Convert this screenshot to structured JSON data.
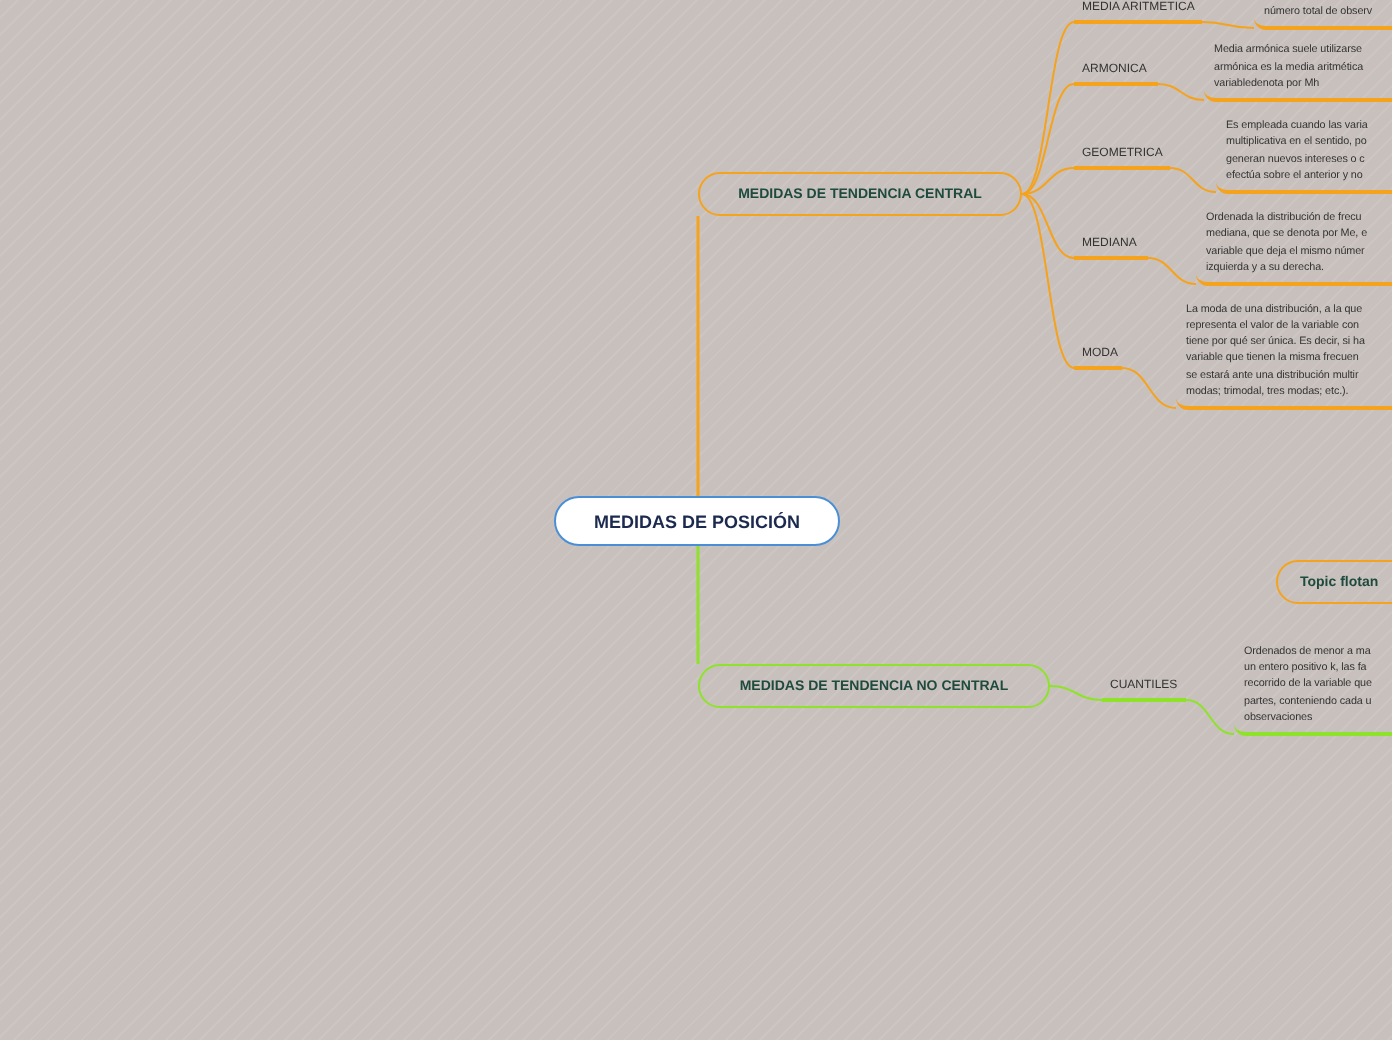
{
  "root": {
    "label": "MEDIDAS DE POSICIÓN"
  },
  "branches": [
    {
      "label": "MEDIDAS DE TENDENCIA CENTRAL",
      "color": "#f5a21c",
      "children": [
        {
          "label": "MEDIA ARITMETICA",
          "note": [
            "número total de observ"
          ]
        },
        {
          "label": "ARMONICA",
          "note": [
            "Media armónica suele utilizarse",
            "armónica es la media aritmética",
            "variabledenota por Mh"
          ]
        },
        {
          "label": "GEOMETRICA",
          "note": [
            "Es empleada cuando las varia",
            "multiplicativa en el sentido, po",
            "generan nuevos intereses o c",
            "efectúa sobre el anterior y no"
          ]
        },
        {
          "label": "MEDIANA",
          "note": [
            "Ordenada la distribución de frecu",
            "mediana, que se denota por Me, e",
            "variable que deja el mismo númer",
            "izquierda y a su derecha."
          ]
        },
        {
          "label": "MODA",
          "note": [
            "La moda de una distribución, a la que",
            "representa el valor de la variable con",
            "tiene por qué ser única. Es decir, si ha",
            "variable que tienen la misma frecuen",
            "se estará ante una distribución multir",
            "modas; trimodal, tres modas; etc.)."
          ]
        }
      ]
    },
    {
      "label": "MEDIDAS DE TENDENCIA NO CENTRAL",
      "color": "#8ee32a",
      "children": [
        {
          "label": "CUANTILES",
          "note": [
            "Ordenados de menor a ma",
            "un entero positivo k, las fa",
            "recorrido de la variable que",
            "partes, conteniendo cada u",
            "observaciones"
          ]
        }
      ]
    }
  ],
  "floating_topic": {
    "label": "Topic flotan"
  }
}
